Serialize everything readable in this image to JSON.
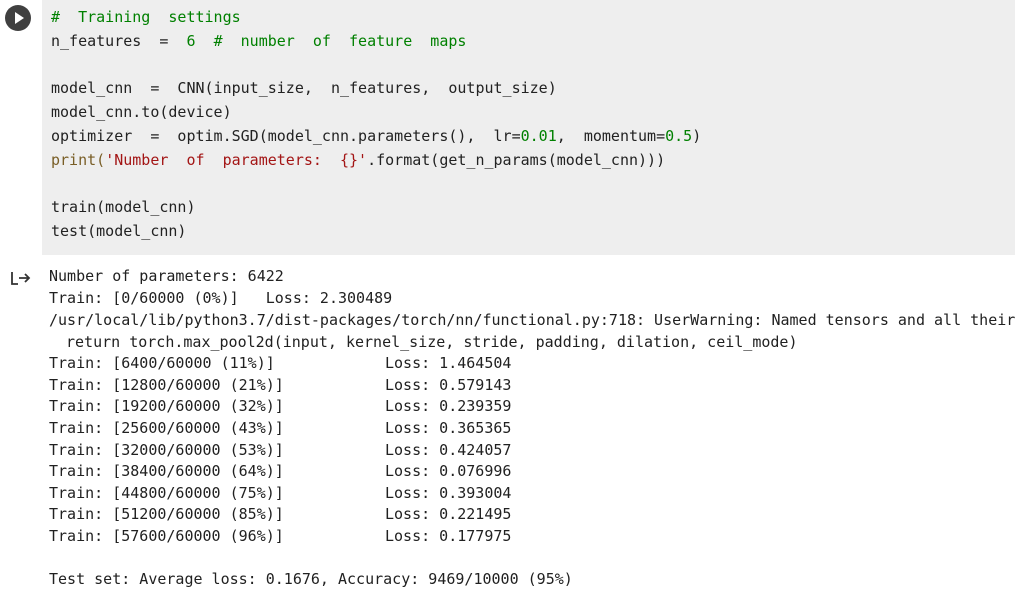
{
  "code": {
    "line1": {
      "comment": "#  Training  settings"
    },
    "line2": {
      "code": "n_features  =  ",
      "num": "6",
      "rest": "  ",
      "comment": "#  number  of  feature  maps"
    },
    "line3": "model_cnn  =  CNN(input_size,  n_features,  output_size)",
    "line4": "model_cnn.to(device)",
    "line5": {
      "code": "optimizer  =  optim.SGD(model_cnn.parameters(),  lr=",
      "lr": "0.01",
      "mid": ",  momentum=",
      "momentum": "0.5",
      "end": ")"
    },
    "line6": {
      "print": "print",
      "paren": "(",
      "string": "'Number  of  parameters:  {}'",
      "rest": ".format(get_n_params(model_cnn)))"
    },
    "line7": "train(model_cnn)",
    "line8": "test(model_cnn)"
  },
  "output": {
    "params": "Number of parameters: 6422",
    "train0": "Train: [0/60000 (0%)]   Loss: 2.300489",
    "warning": "/usr/local/lib/python3.7/dist-packages/torch/nn/functional.py:718: UserWarning: Named tensors and all their",
    "warning_cont": "return torch.max_pool2d(input, kernel_size, stride, padding, dilation, ceil_mode)",
    "train_rows": [
      {
        "progress": "Train: [6400/60000 (11%)]",
        "loss": "Loss: 1.464504"
      },
      {
        "progress": "Train: [12800/60000 (21%)]",
        "loss": "Loss: 0.579143"
      },
      {
        "progress": "Train: [19200/60000 (32%)]",
        "loss": "Loss: 0.239359"
      },
      {
        "progress": "Train: [25600/60000 (43%)]",
        "loss": "Loss: 0.365365"
      },
      {
        "progress": "Train: [32000/60000 (53%)]",
        "loss": "Loss: 0.424057"
      },
      {
        "progress": "Train: [38400/60000 (64%)]",
        "loss": "Loss: 0.076996"
      },
      {
        "progress": "Train: [44800/60000 (75%)]",
        "loss": "Loss: 0.393004"
      },
      {
        "progress": "Train: [51200/60000 (85%)]",
        "loss": "Loss: 0.221495"
      },
      {
        "progress": "Train: [57600/60000 (96%)]",
        "loss": "Loss: 0.177975"
      }
    ],
    "test": "Test set: Average loss: 0.1676, Accuracy: 9469/10000 (95%)"
  }
}
